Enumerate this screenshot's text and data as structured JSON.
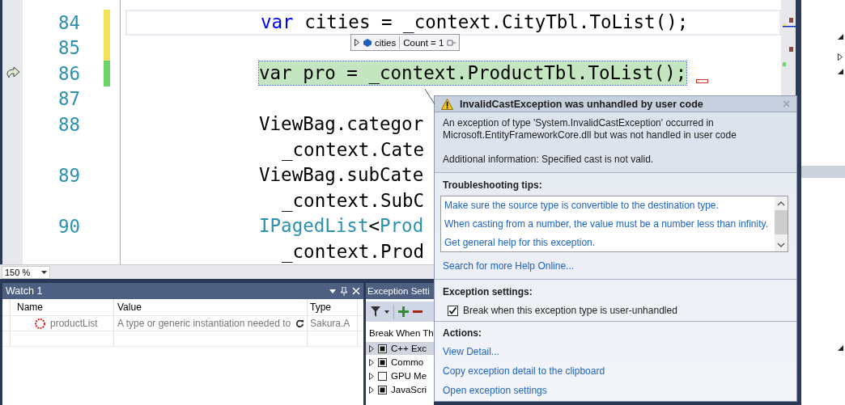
{
  "editor": {
    "lines": [
      {
        "number": "84",
        "color": "#f2e35a",
        "current": true,
        "executing": false,
        "tokens": [
          {
            "kind": "keyword",
            "text": "var"
          },
          {
            "kind": "plain",
            "text": " cities = _context.CityTbl.ToList();"
          }
        ]
      },
      {
        "number": "85",
        "color": "#f2e35a",
        "current": false,
        "executing": false
      },
      {
        "number": "86",
        "color": "#6ad66a",
        "current": false,
        "executing": true,
        "tokens": [
          {
            "kind": "plain",
            "text": "var pro = _context.ProductTbl.ToList();"
          }
        ]
      },
      {
        "number": "87",
        "current": false,
        "executing": false
      },
      {
        "number": "88",
        "current": false,
        "executing": false,
        "tokens": [
          {
            "kind": "plain",
            "text": "ViewBag.categor"
          }
        ]
      },
      {
        "current": false,
        "executing": false,
        "tokens": [
          {
            "kind": "plain",
            "text": "_context.Cate"
          }
        ]
      },
      {
        "number": "89",
        "current": false,
        "executing": false,
        "tokens": [
          {
            "kind": "plain",
            "text": "ViewBag.subCate"
          }
        ]
      },
      {
        "current": false,
        "executing": false,
        "tokens": [
          {
            "kind": "plain",
            "text": "_context.SubC"
          }
        ]
      },
      {
        "number": "90",
        "current": false,
        "executing": false,
        "tokens": [
          {
            "kind": "type",
            "text": "IPagedList"
          },
          {
            "kind": "plain",
            "text": "<"
          },
          {
            "kind": "type",
            "text": "Prod"
          }
        ]
      },
      {
        "current": false,
        "executing": false,
        "tokens": [
          {
            "kind": "plain",
            "text": "_context.Prod"
          }
        ]
      }
    ],
    "datatip": {
      "name": "cities",
      "value": "Count = 1"
    },
    "zoom": "150 %"
  },
  "watch": {
    "title": "Watch 1",
    "columns": [
      "Name",
      "Value",
      "Type"
    ],
    "rows": [
      {
        "name": "productList",
        "value": "A type or generic instantiation needed to",
        "type": "Sakura.A",
        "error": true
      }
    ]
  },
  "exception_settings": {
    "title": "Exception Setti",
    "column_header": "Break When Th",
    "rows": [
      {
        "label": "C++ Exc",
        "checked": true,
        "selected": true
      },
      {
        "label": "Commo",
        "checked": true,
        "selected": false
      },
      {
        "label": "GPU Me",
        "checked": false,
        "selected": false
      },
      {
        "label": "JavaScri",
        "checked": true,
        "selected": false
      }
    ]
  },
  "exception_helper": {
    "title": "InvalidCastException was unhandled by user code",
    "message": "An exception of type 'System.InvalidCastException' occurred in Microsoft.EntityFrameworkCore.dll but was not handled in user code",
    "additional_info": "Additional information: Specified cast is not valid.",
    "tips_heading": "Troubleshooting tips:",
    "tips": [
      "Make sure the source type is convertible to the destination type.",
      "When casting from a number, the value must be a number less than infinity.",
      "Get general help for this exception."
    ],
    "search_link": "Search for more Help Online...",
    "settings_heading": "Exception settings:",
    "break_option": {
      "label": "Break when this exception type is user-unhandled",
      "checked": true
    },
    "actions_heading": "Actions:",
    "actions": [
      "View Detail...",
      "Copy exception detail to the clipboard",
      "Open exception settings"
    ]
  }
}
